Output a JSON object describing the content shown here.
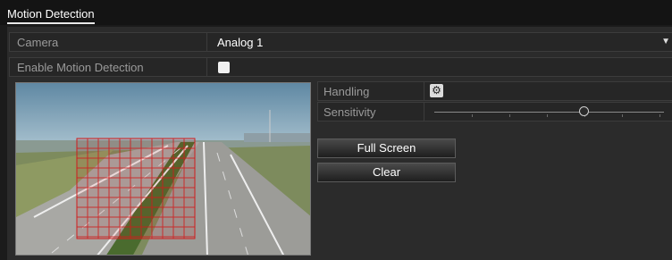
{
  "tab": {
    "label": "Motion Detection"
  },
  "camera": {
    "label": "Camera",
    "value": "Analog 1"
  },
  "enable": {
    "label": "Enable Motion Detection",
    "checked": true
  },
  "handling": {
    "label": "Handling",
    "icon": "gear-icon"
  },
  "sensitivity": {
    "label": "Sensitivity",
    "level": 0.65
  },
  "buttons": {
    "full_screen": "Full Screen",
    "clear": "Clear"
  },
  "colors": {
    "background": "#1b1b1b",
    "panel": "#2b2b2b",
    "grid": "#d01c1c"
  }
}
